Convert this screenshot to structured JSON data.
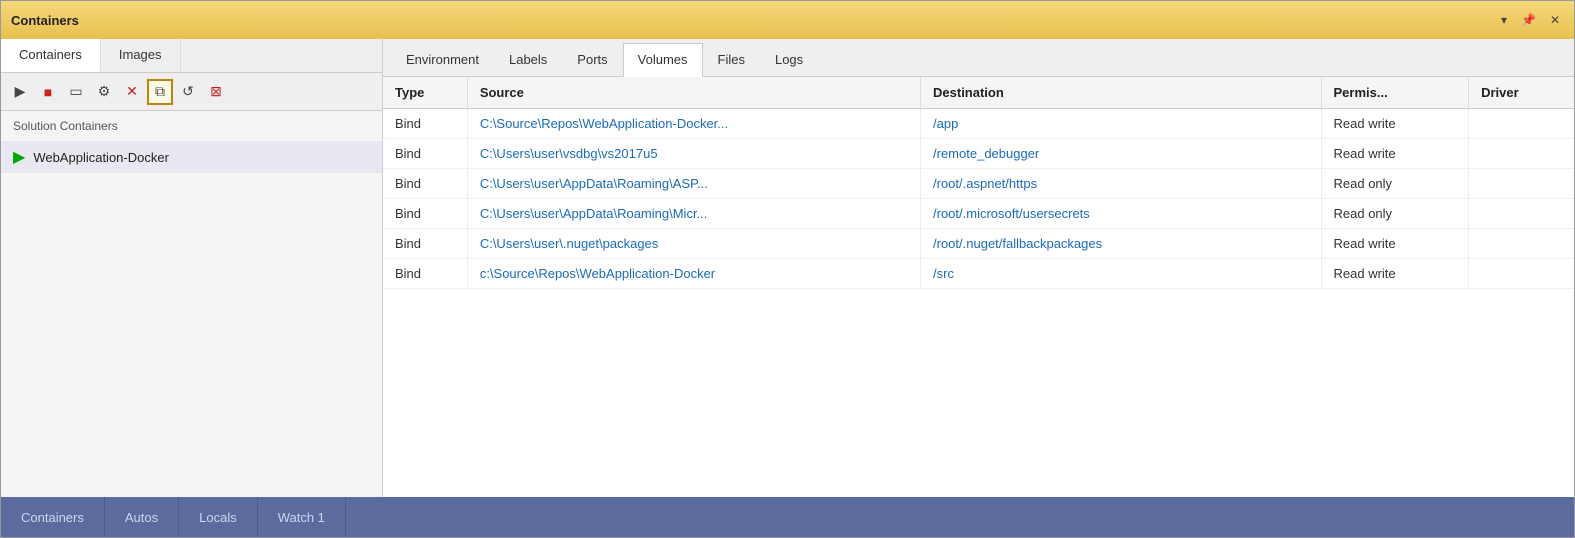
{
  "window": {
    "title": "Containers",
    "title_bar_buttons": [
      "dropdown-icon",
      "pin-icon",
      "close-icon"
    ]
  },
  "left_panel": {
    "tabs": [
      {
        "label": "Containers",
        "active": true
      },
      {
        "label": "Images",
        "active": false
      }
    ],
    "toolbar_buttons": [
      {
        "name": "play-button",
        "icon": "▶",
        "highlighted": false
      },
      {
        "name": "stop-button",
        "icon": "■",
        "highlighted": false
      },
      {
        "name": "terminal-button",
        "icon": "▭",
        "highlighted": false
      },
      {
        "name": "settings-button",
        "icon": "⚙",
        "highlighted": false
      },
      {
        "name": "delete-button",
        "icon": "✕",
        "highlighted": false
      },
      {
        "name": "copy-button",
        "icon": "⧉",
        "highlighted": true
      },
      {
        "name": "refresh-button",
        "icon": "↺",
        "highlighted": false
      },
      {
        "name": "prune-button",
        "icon": "⊠",
        "highlighted": false
      }
    ],
    "section_label": "Solution Containers",
    "containers": [
      {
        "name": "WebApplication-Docker",
        "status": "running"
      }
    ]
  },
  "right_panel": {
    "tabs": [
      {
        "label": "Environment",
        "active": false
      },
      {
        "label": "Labels",
        "active": false
      },
      {
        "label": "Ports",
        "active": false
      },
      {
        "label": "Volumes",
        "active": true
      },
      {
        "label": "Files",
        "active": false
      },
      {
        "label": "Logs",
        "active": false
      }
    ],
    "table": {
      "columns": [
        {
          "label": "Type",
          "key": "type"
        },
        {
          "label": "Source",
          "key": "source"
        },
        {
          "label": "Destination",
          "key": "destination"
        },
        {
          "label": "Permis...",
          "key": "permissions"
        },
        {
          "label": "Driver",
          "key": "driver"
        }
      ],
      "rows": [
        {
          "type": "Bind",
          "source": "C:\\Source\\Repos\\WebApplication-Docker...",
          "destination": "/app",
          "permissions": "Read write",
          "driver": ""
        },
        {
          "type": "Bind",
          "source": "C:\\Users\\user\\vsdbg\\vs2017u5",
          "destination": "/remote_debugger",
          "permissions": "Read write",
          "driver": ""
        },
        {
          "type": "Bind",
          "source": "C:\\Users\\user\\AppData\\Roaming\\ASP...",
          "destination": "/root/.aspnet/https",
          "permissions": "Read only",
          "driver": ""
        },
        {
          "type": "Bind",
          "source": "C:\\Users\\user\\AppData\\Roaming\\Micr...",
          "destination": "/root/.microsoft/usersecrets",
          "permissions": "Read only",
          "driver": ""
        },
        {
          "type": "Bind",
          "source": "C:\\Users\\user\\.nuget\\packages",
          "destination": "/root/.nuget/fallbackpackages",
          "permissions": "Read write",
          "driver": ""
        },
        {
          "type": "Bind",
          "source": "c:\\Source\\Repos\\WebApplication-Docker",
          "destination": "/src",
          "permissions": "Read write",
          "driver": ""
        }
      ]
    }
  },
  "bottom_bar": {
    "tabs": [
      {
        "label": "Containers",
        "active": false
      },
      {
        "label": "Autos",
        "active": false
      },
      {
        "label": "Locals",
        "active": false
      },
      {
        "label": "Watch 1",
        "active": false
      }
    ]
  }
}
